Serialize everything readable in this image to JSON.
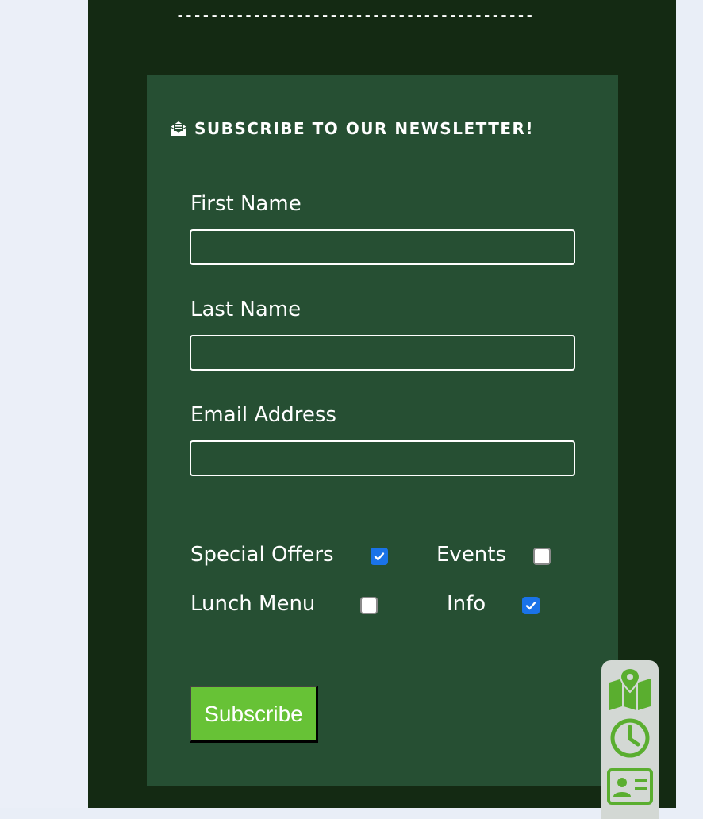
{
  "divider_text": "------------------------------------------",
  "newsletter": {
    "icon": "envelope-open-text-icon",
    "heading": "SUBSCRIBE TO OUR NEWSLETTER!",
    "fields": [
      {
        "label": "First Name",
        "value": ""
      },
      {
        "label": "Last Name",
        "value": ""
      },
      {
        "label": "Email Address",
        "value": ""
      }
    ],
    "options": [
      {
        "label": "Special Offers",
        "checked": true
      },
      {
        "label": "Events",
        "checked": false
      },
      {
        "label": "Lunch Menu",
        "checked": false
      },
      {
        "label": "Info",
        "checked": true
      }
    ],
    "submit_label": "Subscribe"
  },
  "dock": {
    "icons": [
      "map-location-icon",
      "clock-icon",
      "contact-card-icon"
    ]
  },
  "colors": {
    "panel_bg": "#142a13",
    "card_bg": "#264f33",
    "button_bg": "#67c236",
    "dock_icon": "#5aae2f",
    "checkbox_checked": "#1a73e8"
  }
}
